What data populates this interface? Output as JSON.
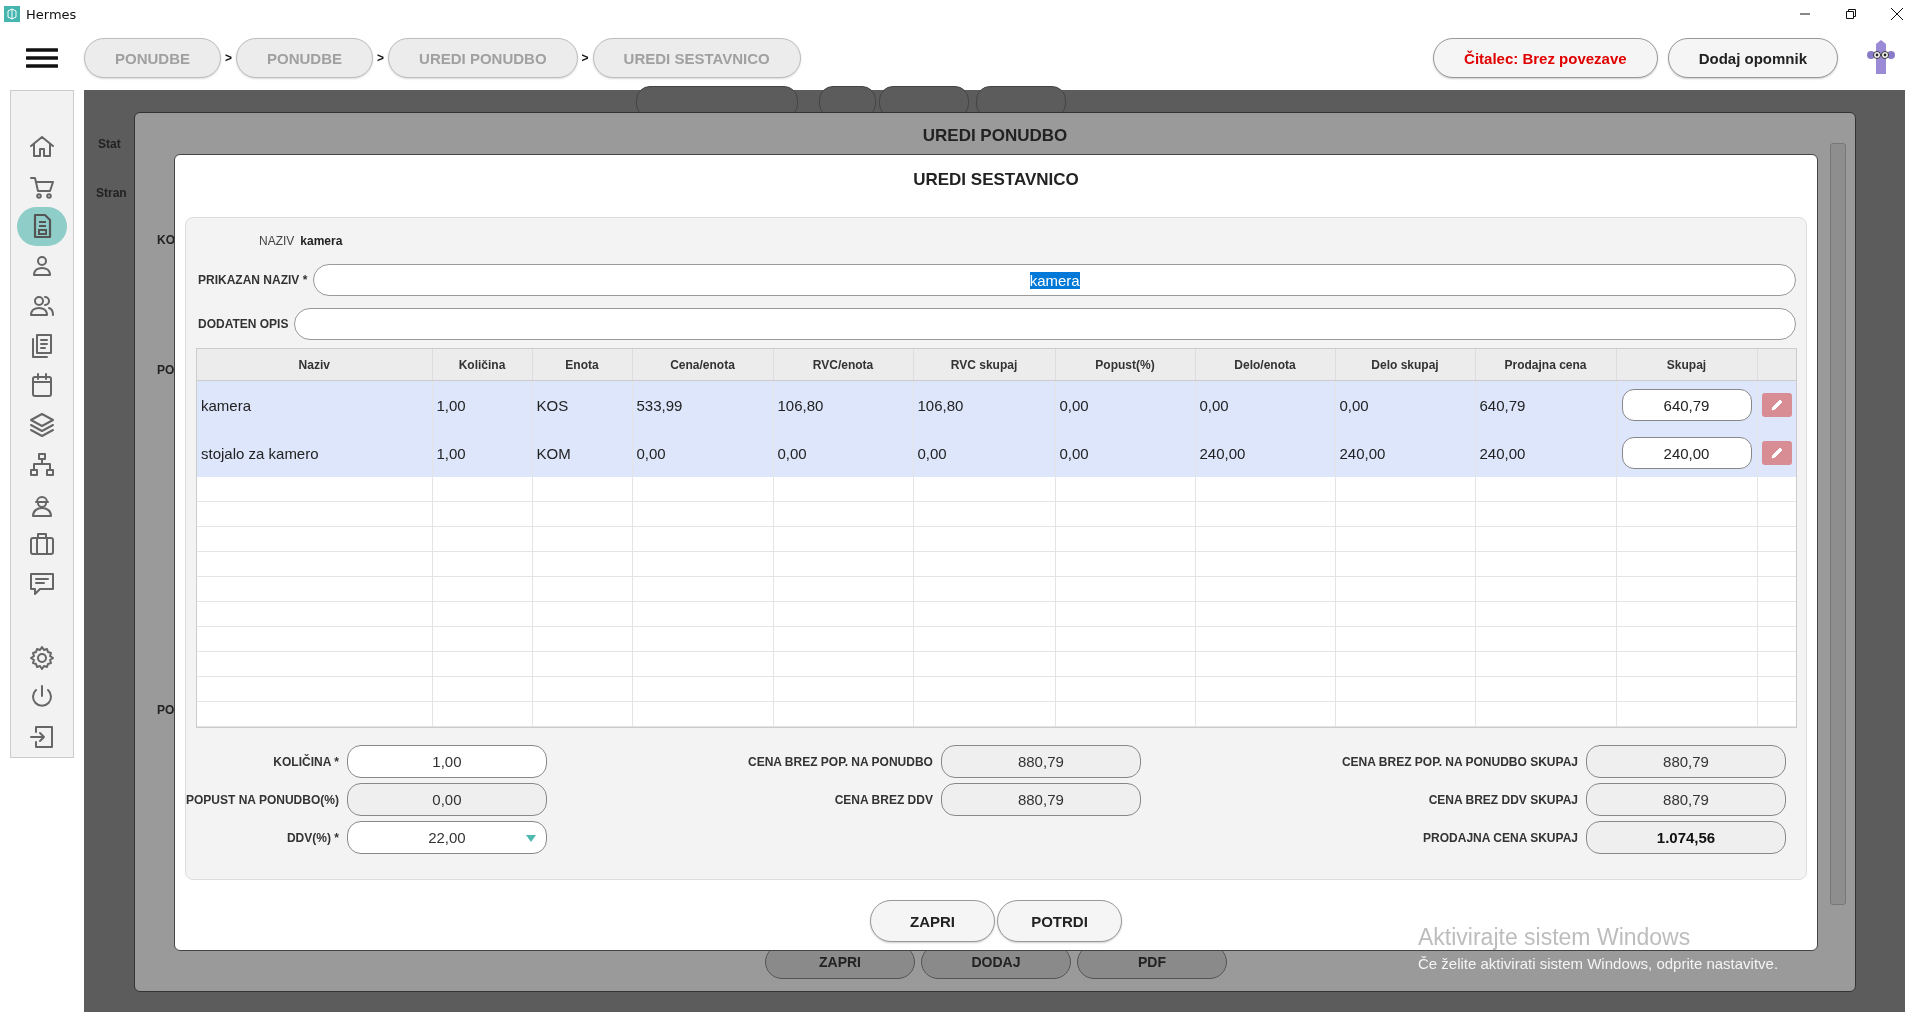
{
  "window": {
    "title": "Hermes"
  },
  "breadcrumbs": [
    {
      "kind": "crumb",
      "label": "PONUDBE"
    },
    {
      "kind": "separator",
      "text": ">"
    },
    {
      "kind": "crumb",
      "label": "PONUDBE"
    },
    {
      "kind": "separator",
      "text": ">"
    },
    {
      "kind": "crumb",
      "label": "UREDI PONUDBO"
    },
    {
      "kind": "separator",
      "text": ">"
    },
    {
      "kind": "crumb",
      "label": "UREDI SESTAVNICO"
    }
  ],
  "top_actions": [
    {
      "kind": "status",
      "label": "Čitalec: Brez povezave"
    },
    {
      "kind": "button",
      "label": "Dodaj opomnik"
    }
  ],
  "sidebar": {
    "items": [
      {
        "selected": false
      },
      {
        "selected": false
      },
      {
        "selected": true
      },
      {
        "selected": false
      },
      {
        "selected": false
      },
      {
        "selected": false
      },
      {
        "selected": false
      },
      {
        "selected": false
      },
      {
        "selected": false
      },
      {
        "selected": false
      },
      {
        "selected": false
      },
      {
        "selected": false
      },
      {
        "selected": false
      },
      {
        "selected": false
      },
      {
        "selected": false
      }
    ]
  },
  "background": {
    "labels": [
      "Stat",
      "Stran",
      "KO",
      "PO",
      "PO"
    ],
    "buttons": [
      "ZAPRI",
      "DODAJ",
      "PDF"
    ]
  },
  "outer_dialog": {
    "title": "UREDI PONUDBO"
  },
  "dialog": {
    "title": "UREDI SESTAVNICO",
    "name_label": "NAZIV",
    "name_value": "kamera",
    "display_name": {
      "label": "PRIKAZAN NAZIV *",
      "value": "kamera",
      "value_selected": true
    },
    "extra_description": {
      "label": "DODATEN OPIS"
    },
    "table": {
      "columns": [
        "Naziv",
        "Količina",
        "Enota",
        "Cena/enota",
        "RVC/enota",
        "RVC skupaj",
        "Popust(%)",
        "Delo/enota",
        "Delo skupaj",
        "Prodajna cena",
        "Skupaj"
      ],
      "rows": [
        {
          "selected": true,
          "cells": [
            "kamera",
            "1,00",
            "KOS",
            "533,99",
            "106,80",
            "106,80",
            "0,00",
            "0,00",
            "0,00",
            "640,79"
          ],
          "total": "640,79"
        },
        {
          "selected": true,
          "cells": [
            "stojalo za kamero",
            "1,00",
            "KOM",
            "0,00",
            "0,00",
            "0,00",
            "0,00",
            "240,00",
            "240,00",
            "240,00"
          ],
          "total": "240,00"
        }
      ]
    },
    "summary_columns": [
      {
        "fields": [
          {
            "kind": "input",
            "label": "KOLIČINA *",
            "value": "1,00"
          },
          {
            "kind": "readonly",
            "label": "POPUST NA PONUDBO(%)",
            "value": "0,00"
          },
          {
            "kind": "select",
            "label": "DDV(%) *",
            "value": "22,00"
          }
        ]
      },
      {
        "fields": [
          {
            "kind": "readonly",
            "label": "CENA BREZ POP. NA PONUDBO",
            "value": "880,79"
          },
          {
            "kind": "readonly",
            "label": "CENA BREZ DDV",
            "value": "880,79"
          }
        ]
      },
      {
        "fields": [
          {
            "kind": "readonly",
            "label": "CENA BREZ POP. NA PONUDBO SKUPAJ",
            "value": "880,79"
          },
          {
            "kind": "readonly",
            "label": "CENA BREZ DDV SKUPAJ",
            "value": "880,79"
          },
          {
            "kind": "total",
            "label": "PRODAJNA CENA SKUPAJ",
            "value": "1.074,56"
          }
        ]
      }
    ],
    "buttons": [
      "ZAPRI",
      "POTRDI"
    ]
  },
  "system_notice": {
    "title": "Aktivirajte sistem Windows",
    "text": "Če želite aktivirati sistem Windows, odprite nastavitve."
  }
}
